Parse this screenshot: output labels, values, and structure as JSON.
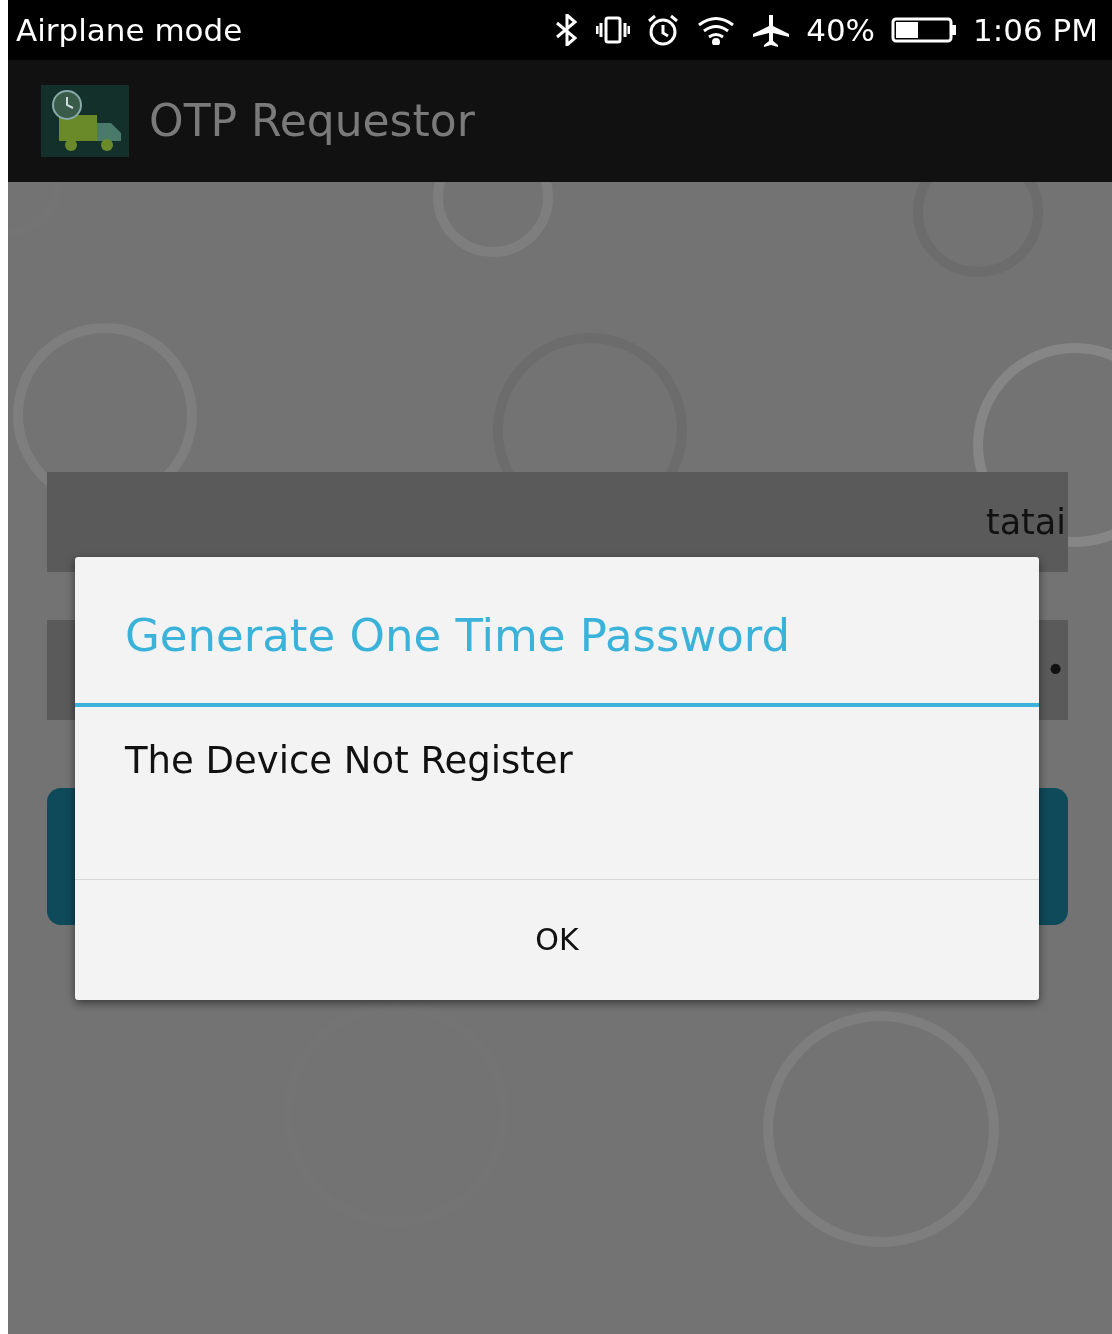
{
  "status_bar": {
    "left": "Airplane mode",
    "battery": "40%",
    "time": "1:06 PM"
  },
  "app_bar": {
    "title": "OTP Requestor"
  },
  "form": {
    "username": "tatai",
    "password_visible": "•"
  },
  "dialog": {
    "title": "Generate One Time Password",
    "message": "The Device Not Register",
    "buttons": [
      "OK"
    ]
  }
}
